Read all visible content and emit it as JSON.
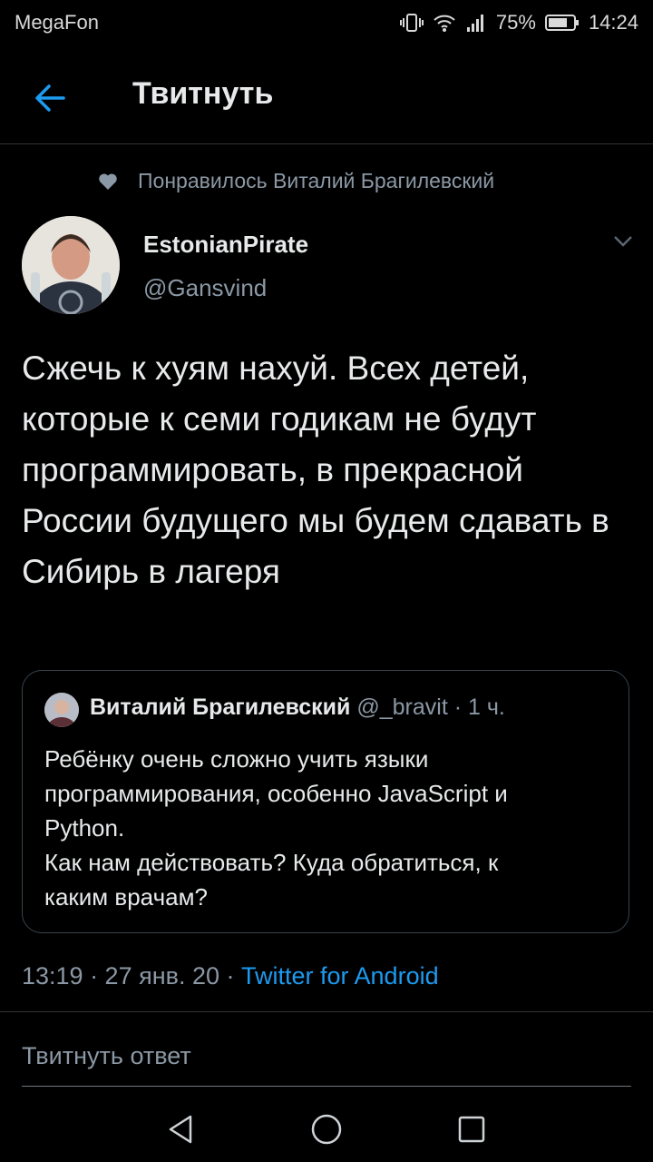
{
  "status_bar": {
    "carrier": "MegaFon",
    "battery": "75%",
    "time": "14:24"
  },
  "header": {
    "title": "Твитнуть"
  },
  "liked_by": "Понравилось Виталий Брагилевский",
  "tweet": {
    "author_name": "EstonianPirate",
    "author_handle": "@Gansvind",
    "text": "Сжечь к хуям нахуй. Всех детей, которые к семи годикам не будут программировать, в прекрасной России будущего мы будем сдавать в Сибирь в лагеря",
    "quote": {
      "author_name": "Виталий Брагилевский",
      "author_meta": "@_bravit · 1 ч.",
      "text_lines": [
        "Ребёнку очень сложно учить языки",
        "программирования, особенно JavaScript и",
        "Python.",
        "Как нам действовать? Куда обратиться, к",
        "каким врачам?"
      ]
    },
    "timestamp": "13:19 · 27 янв. 20 · ",
    "source": "Twitter for Android"
  },
  "reply": {
    "placeholder": "Твитнуть ответ"
  },
  "colors": {
    "background": "#000000",
    "accent": "#1d9bf0",
    "secondary_text": "#8b98a5"
  }
}
